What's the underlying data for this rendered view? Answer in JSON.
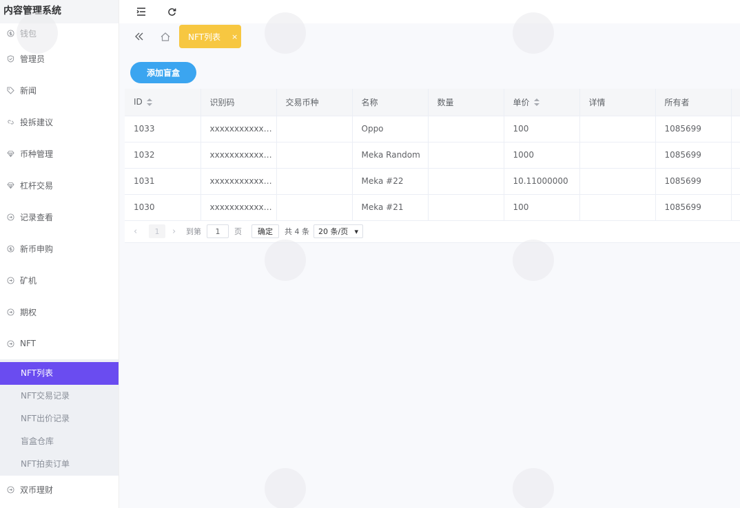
{
  "app": {
    "title": "内容管理系统"
  },
  "sidebar": {
    "items": [
      {
        "label": "钱包",
        "icon": "dollar-circle-icon"
      },
      {
        "label": "管理员",
        "icon": "shield-icon"
      },
      {
        "label": "新闻",
        "icon": "tag-icon"
      },
      {
        "label": "投拆建议",
        "icon": "link-icon"
      },
      {
        "label": "币种管理",
        "icon": "diamond-icon"
      },
      {
        "label": "杠杆交易",
        "icon": "diamond-icon"
      },
      {
        "label": "记录查看",
        "icon": "circle-arrow-icon"
      },
      {
        "label": "新币申购",
        "icon": "dollar-circle-icon"
      },
      {
        "label": "矿机",
        "icon": "circle-arrow-icon"
      },
      {
        "label": "期权",
        "icon": "circle-arrow-icon"
      },
      {
        "label": "NFT",
        "icon": "circle-arrow-icon"
      }
    ],
    "nft_sub": [
      {
        "label": "NFT列表",
        "active": true
      },
      {
        "label": "NFT交易记录",
        "active": false
      },
      {
        "label": "NFT出价记录",
        "active": false
      },
      {
        "label": "盲盒仓库",
        "active": false
      },
      {
        "label": "NFT拍卖订单",
        "active": false
      }
    ],
    "last_item": {
      "label": "双币理财",
      "icon": "circle-arrow-icon"
    }
  },
  "tabs": {
    "active_label": "NFT列表",
    "close_glyph": "×"
  },
  "toolbar": {
    "add_label": "添加盲盒"
  },
  "table": {
    "columns": [
      "ID",
      "识别码",
      "交易币种",
      "名称",
      "数量",
      "单价",
      "详情",
      "所有者"
    ],
    "rows": [
      [
        "1033",
        "xxxxxxxxxxxxxxxxxx",
        "",
        "Oppo",
        "",
        "100",
        "",
        "1085699"
      ],
      [
        "1032",
        "xxxxxxxxxxxxxxxxxx",
        "",
        "Meka Random",
        "",
        "1000",
        "",
        "1085699"
      ],
      [
        "1031",
        "xxxxxxxxxxxxxxxxxx",
        "",
        "Meka #22",
        "",
        "10.11000000",
        "",
        "1085699"
      ],
      [
        "1030",
        "xxxxxxxxxxxxxxxxxx",
        "",
        "Meka #21",
        "",
        "100",
        "",
        "1085699"
      ]
    ]
  },
  "pager": {
    "current": "1",
    "goto_label": "到第",
    "goto_value": "1",
    "page_unit": "页",
    "confirm_label": "确定",
    "total_label": "共 4 条",
    "page_size": "20 条/页"
  },
  "colors": {
    "accent": "#6a4cf0",
    "tab": "#f7c741",
    "button": "#3ba5f0"
  }
}
